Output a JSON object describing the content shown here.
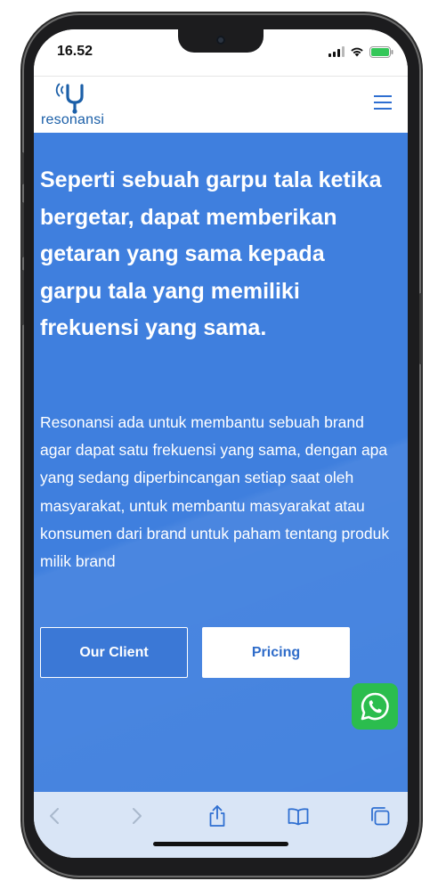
{
  "status_bar": {
    "time": "16.52"
  },
  "header": {
    "logo_text": "resonansi",
    "menu_icon": "hamburger-icon"
  },
  "hero": {
    "title": "Seperti sebuah garpu tala ketika bergetar, dapat memberikan getaran yang sama kepada garpu tala yang memiliki frekuensi yang sama.",
    "description": "Resonansi ada untuk membantu sebuah brand agar dapat satu frekuensi yang sama, dengan apa yang sedang diperbincangan setiap saat oleh masyarakat, untuk membantu masyarakat atau konsumen dari brand untuk paham tentang produk milik brand",
    "buttons": {
      "client_label": "Our Client",
      "pricing_label": "Pricing"
    }
  },
  "whatsapp": {
    "icon": "whatsapp-icon"
  },
  "toolbar": {
    "icons": [
      "back-icon",
      "forward-icon",
      "share-icon",
      "bookmarks-icon",
      "tabs-icon"
    ]
  },
  "colors": {
    "hero_background": "#3f7fde",
    "brand_blue": "#1b5fa8",
    "whatsapp_green": "#2bbd4e",
    "toolbar_background": "#d9e5f6"
  }
}
